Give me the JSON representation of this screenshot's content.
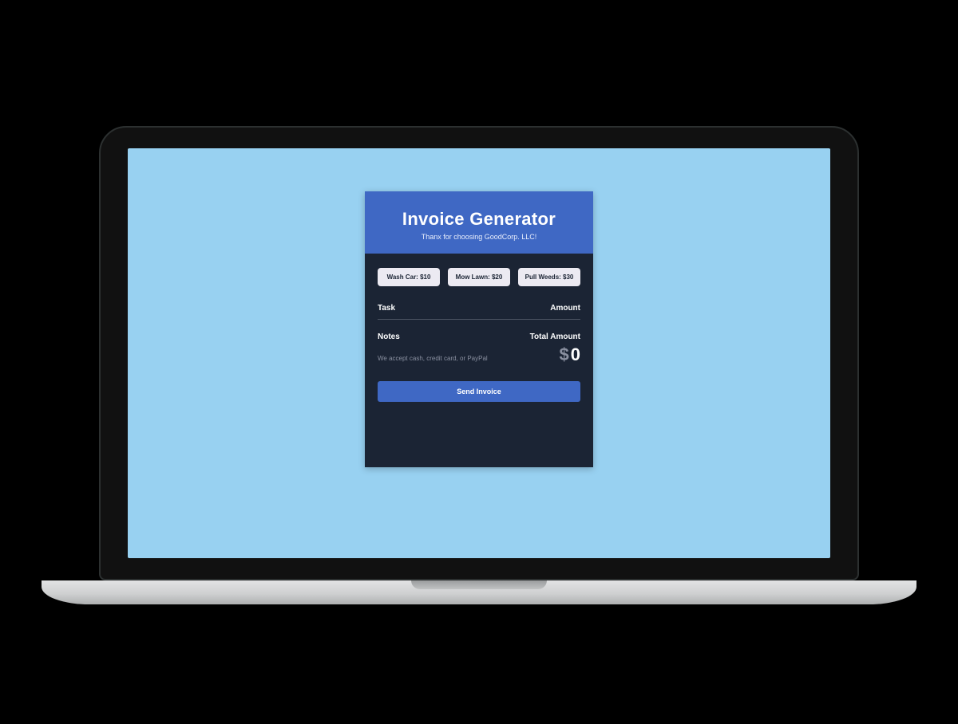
{
  "header": {
    "title": "Invoice Generator",
    "subtitle": "Thanx for choosing GoodCorp. LLC!"
  },
  "chips": [
    {
      "label": "Wash Car: $10"
    },
    {
      "label": "Mow Lawn: $20"
    },
    {
      "label": "Pull Weeds: $30"
    }
  ],
  "columns": {
    "task": "Task",
    "amount": "Amount"
  },
  "notes": {
    "label": "Notes",
    "text": "We accept cash, credit card, or PayPal"
  },
  "total": {
    "label": "Total Amount",
    "currency": "$",
    "value": "0"
  },
  "actions": {
    "send": "Send Invoice"
  }
}
